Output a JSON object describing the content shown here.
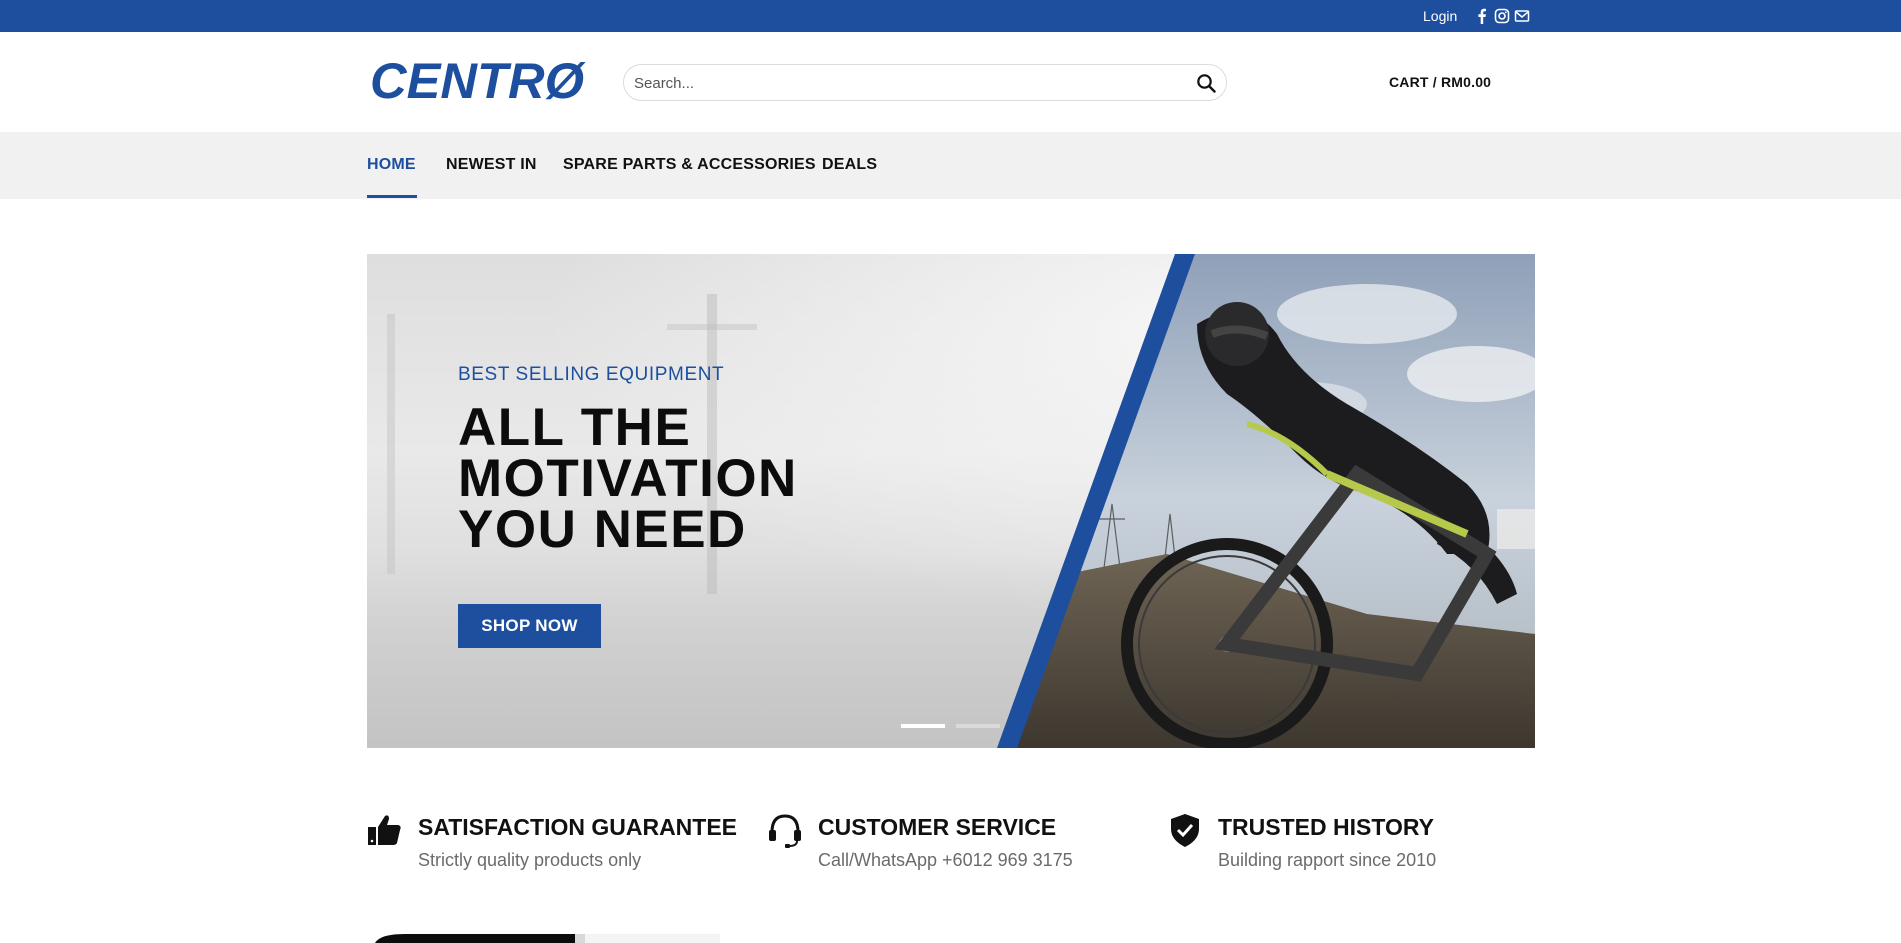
{
  "topbar": {
    "login_label": "Login",
    "social_icons": [
      "facebook-icon",
      "instagram-icon",
      "mail-icon"
    ],
    "background": "#1d4f9e"
  },
  "header": {
    "logo_text": "CENTRØ",
    "search_placeholder": "Search...",
    "cart_label": "CART / RM0.00"
  },
  "nav": {
    "items": [
      {
        "label": "HOME",
        "active": true
      },
      {
        "label": "NEWEST IN",
        "active": false
      },
      {
        "label": "SPARE PARTS & ACCESSORIES",
        "active": false
      },
      {
        "label": "DEALS",
        "active": false
      }
    ]
  },
  "hero": {
    "eyebrow": "BEST SELLING EQUIPMENT",
    "headline_lines": [
      "ALL THE",
      "MOTIVATION",
      "YOU NEED"
    ],
    "cta_label": "SHOP NOW",
    "slides": {
      "count": 2,
      "active_index": 0
    }
  },
  "features": [
    {
      "icon": "thumbs-up-icon",
      "title": "SATISFACTION GUARANTEE",
      "subtitle": "Strictly quality products only"
    },
    {
      "icon": "headset-icon",
      "title": "CUSTOMER SERVICE",
      "subtitle": "Call/WhatsApp +6012 969 3175"
    },
    {
      "icon": "shield-check-icon",
      "title": "TRUSTED HISTORY",
      "subtitle": "Building rapport since 2010"
    }
  ],
  "colors": {
    "accent": "#1d4f9e",
    "nav_background": "#f1f1f1",
    "text_dark": "#111111",
    "text_muted": "#6b6b6b"
  }
}
